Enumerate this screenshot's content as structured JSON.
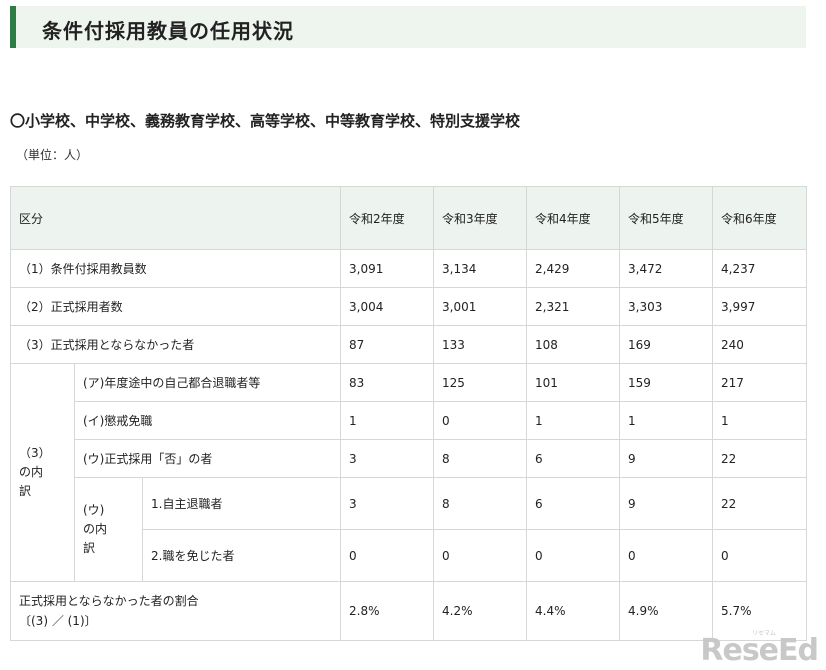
{
  "page_title": "条件付採用教員の任用状況",
  "section_heading": "〇小学校、中学校、義務教育学校、高等学校、中等教育学校、特別支援学校",
  "unit_note": "（単位：人）",
  "table": {
    "header": {
      "category": "区分",
      "years": [
        "令和2年度",
        "令和3年度",
        "令和4年度",
        "令和5年度",
        "令和6年度"
      ]
    },
    "row1": {
      "label": "（1）条件付採用教員数",
      "values": [
        "3,091",
        "3,134",
        "2,429",
        "3,472",
        "4,237"
      ]
    },
    "row2": {
      "label": "（2）正式採用者数",
      "values": [
        "3,004",
        "3,001",
        "2,321",
        "3,303",
        "3,997"
      ]
    },
    "row3": {
      "label": "（3）正式採用とならなかった者",
      "values": [
        "87",
        "133",
        "108",
        "169",
        "240"
      ]
    },
    "breakdown_group_label": "（3）の内訳",
    "rowA": {
      "label": "(ア)年度途中の自己都合退職者等",
      "values": [
        "83",
        "125",
        "101",
        "159",
        "217"
      ]
    },
    "rowI": {
      "label": "(イ)懲戒免職",
      "values": [
        "1",
        "0",
        "1",
        "1",
        "1"
      ]
    },
    "rowU": {
      "label": "(ウ)正式採用「否」の者",
      "values": [
        "3",
        "8",
        "6",
        "9",
        "22"
      ]
    },
    "u_breakdown_group_label": "(ウ)の内訳",
    "rowU1": {
      "label": "1.自主退職者",
      "values": [
        "3",
        "8",
        "6",
        "9",
        "22"
      ]
    },
    "rowU2": {
      "label": "2.職を免じた者",
      "values": [
        "0",
        "0",
        "0",
        "0",
        "0"
      ]
    },
    "ratio": {
      "label_line1": "正式採用とならなかった者の割合",
      "label_line2": "〔(3) ／ (1)〕",
      "values": [
        "2.8%",
        "4.2%",
        "4.4%",
        "4.9%",
        "5.7%"
      ]
    }
  },
  "watermark": {
    "text": "ReseEd",
    "small_text": "リセマム"
  }
}
